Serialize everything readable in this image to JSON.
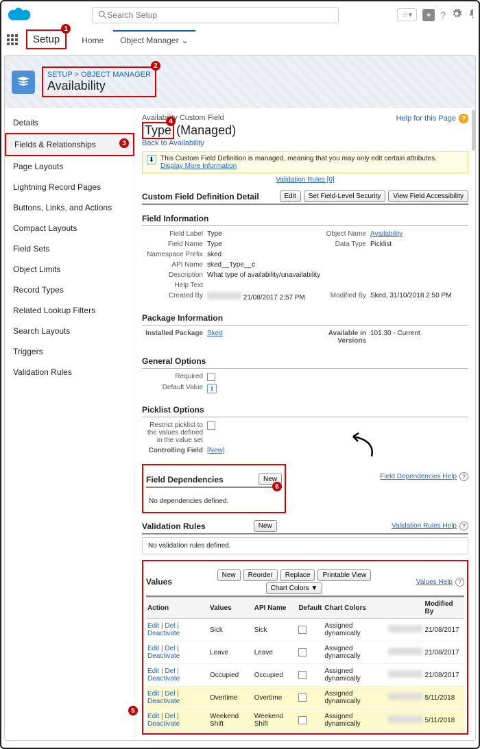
{
  "top": {
    "search_placeholder": "Search Setup",
    "help": "?"
  },
  "nav": {
    "setup": "Setup",
    "tabs": [
      "Home",
      "Object Manager"
    ]
  },
  "header": {
    "breadcrumb_setup": "SETUP",
    "breadcrumb_sep": " > ",
    "breadcrumb_om": "OBJECT MANAGER",
    "title": "Availability"
  },
  "sidebar": {
    "items": [
      "Details",
      "Fields & Relationships",
      "Page Layouts",
      "Lightning Record Pages",
      "Buttons, Links, and Actions",
      "Compact Layouts",
      "Field Sets",
      "Object Limits",
      "Record Types",
      "Related Lookup Filters",
      "Search Layouts",
      "Triggers",
      "Validation Rules"
    ],
    "selected_index": 1
  },
  "main": {
    "heading_prefix": "Availability Custom Field",
    "type_label": "Type",
    "managed_label": "(Managed)",
    "back_link": "Back to Availability",
    "help_page": "Help for this Page",
    "banner": "This Custom Field Definition is managed, meaning that you may only edit certain attributes.",
    "banner_more": "Display More Information",
    "validation_link": "Validation Rules [0]",
    "detail_title": "Custom Field Definition Detail",
    "detail_buttons": [
      "Edit",
      "Set Field-Level Security",
      "View Field Accessibility"
    ],
    "field_info_title": "Field Information",
    "field_info": {
      "field_label": "Type",
      "object_name": "Availability",
      "field_name": "Type",
      "data_type": "Picklist",
      "ns_prefix": "sked",
      "api_name": "sked__Type__c",
      "description": "What type of availability/unavailability",
      "help_text": "",
      "created_by_date": "21/08/2017 2:57 PM",
      "modified_by": "Sked, 31/10/2018 2:50 PM"
    },
    "labels": {
      "field_label": "Field Label",
      "object_name": "Object Name",
      "field_name": "Field Name",
      "data_type": "Data Type",
      "ns_prefix": "Namespace Prefix",
      "api_name": "API Name",
      "description": "Description",
      "help_text": "Help Text",
      "created_by": "Created By",
      "modified_by": "Modified By"
    },
    "pkg_title": "Package Information",
    "pkg": {
      "installed_label": "Installed Package",
      "installed_val": "Sked",
      "avail_label": "Available in Versions",
      "avail_val": "101.30 - Current"
    },
    "gen_title": "General Options",
    "gen": {
      "required": "Required",
      "default": "Default Value"
    },
    "pick_title": "Picklist Options",
    "pick": {
      "restrict": "Restrict picklist to the values defined in the value set",
      "controlling": "Controlling Field",
      "controlling_val": "[New]"
    },
    "dep_title": "Field Dependencies",
    "dep_btn": "New",
    "dep_help": "Field Dependencies Help",
    "dep_msg": "No dependencies defined.",
    "val_title": "Validation Rules",
    "val_btn": "New",
    "val_help": "Validation Rules Help",
    "val_msg": "No validation rules defined.",
    "values_title": "Values",
    "values_btns": [
      "New",
      "Reorder",
      "Replace",
      "Printable View"
    ],
    "values_btns2": "Chart Colors ▼",
    "values_help": "Values Help",
    "values_cols": [
      "Action",
      "Values",
      "API Name",
      "Default",
      "Chart Colors",
      "",
      "Modified By"
    ],
    "values_actions": {
      "edit": "Edit",
      "del": "Del",
      "deact": "Deactivate"
    },
    "values_rows": [
      {
        "v": "Sick",
        "a": "Sick",
        "cc": "Assigned dynamically",
        "mb": "21/08/2017",
        "hl": false
      },
      {
        "v": "Leave",
        "a": "Leave",
        "cc": "Assigned dynamically",
        "mb": "21/08/2017",
        "hl": false
      },
      {
        "v": "Occupied",
        "a": "Occupied",
        "cc": "Assigned dynamically",
        "mb": "21/08/2017",
        "hl": false
      },
      {
        "v": "Overtime",
        "a": "Overtime",
        "cc": "Assigned dynamically",
        "mb": "5/11/2018",
        "hl": true
      },
      {
        "v": "Weekend Shift",
        "a": "Weekend Shift",
        "cc": "Assigned dynamically",
        "mb": "5/11/2018",
        "hl": true
      }
    ]
  },
  "badges": {
    "b1": "1",
    "b2": "2",
    "b3": "3",
    "b4": "4",
    "b5": "5",
    "b6": "6"
  }
}
